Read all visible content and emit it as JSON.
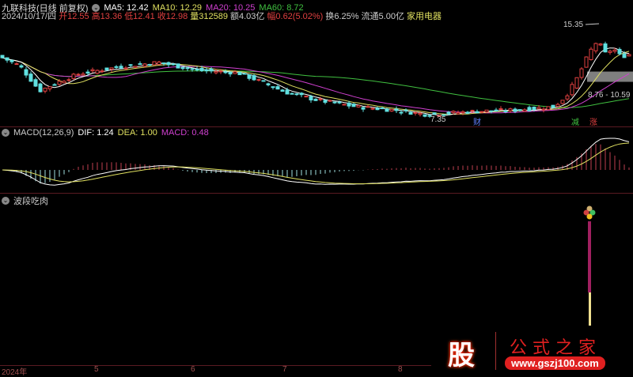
{
  "header": {
    "title": "九联科技(日线 前复权)",
    "ma5": "MA5: 12.42",
    "ma10": "MA10: 12.29",
    "ma20": "MA20: 10.25",
    "ma60": "MA60: 8.72",
    "date": "2024/10/17/四",
    "open": "开12.55",
    "high": "高13.36",
    "low": "低12.41",
    "close": "收12.98",
    "volume": "量312589",
    "amount": "额4.03亿",
    "change": "幅0.62(5.02%)",
    "turnover": "换6.25%",
    "float": "流通5.00亿",
    "industry": "家用电器"
  },
  "annotations": {
    "high": "15.35",
    "low": "7.35",
    "range": "8.76 - 10.59",
    "tag1": "财",
    "tag2": "减",
    "tag3": "涨"
  },
  "macd": {
    "title": "MACD(12,26,9)",
    "dif": "DIF: 1.24",
    "dea": "DEA: 1.00",
    "macd": "MACD: 0.48"
  },
  "indicator": {
    "title": "波段吃肉"
  },
  "axis": {
    "labels": [
      "2024年",
      "5",
      "6",
      "7",
      "8"
    ]
  },
  "watermark": {
    "logo_char": "股",
    "name": "公式之家",
    "url": "www.gszj100.com"
  },
  "colors": {
    "up": "#e04040",
    "down": "#60e0e0",
    "ma5": "#ffffff",
    "ma10": "#e0e060",
    "ma20": "#d040d0",
    "ma60": "#40c040"
  },
  "price_trend": [
    [
      0,
      12.8
    ],
    [
      25,
      12.0
    ],
    [
      50,
      9.8
    ],
    [
      75,
      10.6
    ],
    [
      100,
      11.3
    ],
    [
      150,
      11.9
    ],
    [
      200,
      12.3
    ],
    [
      250,
      11.6
    ],
    [
      300,
      11.4
    ],
    [
      330,
      10.6
    ],
    [
      360,
      9.7
    ],
    [
      400,
      9.0
    ],
    [
      450,
      8.4
    ],
    [
      500,
      8.1
    ],
    [
      540,
      7.7
    ],
    [
      600,
      8.0
    ],
    [
      650,
      8.1
    ],
    [
      700,
      8.4
    ],
    [
      715,
      9.3
    ],
    [
      730,
      11.0
    ],
    [
      745,
      13.2
    ],
    [
      755,
      14.2
    ],
    [
      765,
      13.1
    ],
    [
      775,
      13.5
    ],
    [
      785,
      12.8
    ],
    [
      795,
      13.0
    ]
  ]
}
